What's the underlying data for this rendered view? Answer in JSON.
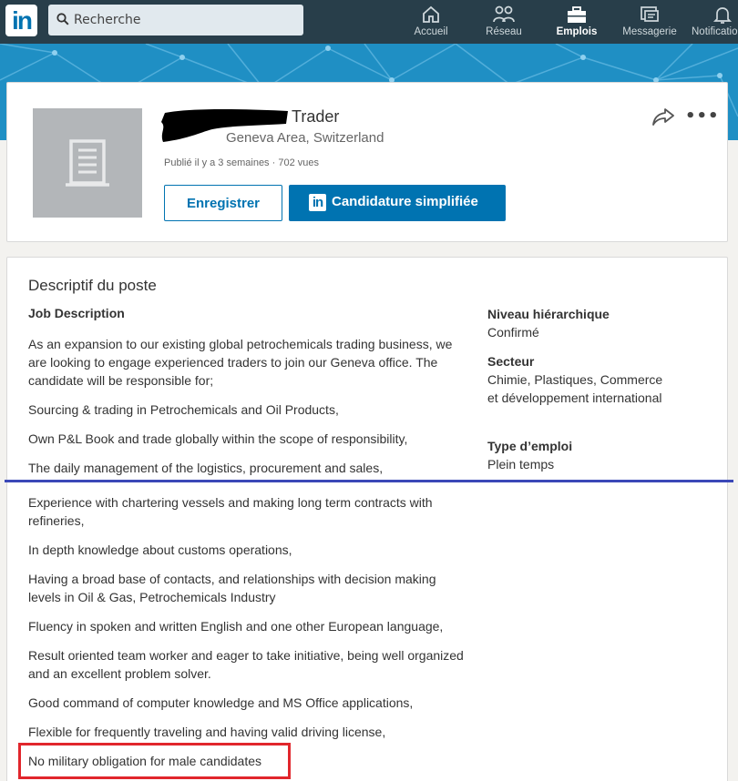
{
  "nav": {
    "logo": "in",
    "search_placeholder": "Recherche",
    "items": [
      {
        "label": "Accueil",
        "icon": "home-icon"
      },
      {
        "label": "Réseau",
        "icon": "network-icon"
      },
      {
        "label": "Emplois",
        "icon": "briefcase-icon",
        "active": true
      },
      {
        "label": "Messagerie",
        "icon": "messaging-icon"
      },
      {
        "label": "Notifications",
        "icon": "bell-icon"
      }
    ]
  },
  "job": {
    "title": "Trader",
    "location": "Geneva Area, Switzerland",
    "meta": "Publié il y a 3 semaines · 702 vues",
    "save_label": "Enregistrer",
    "apply_label": "Candidature simplifiée",
    "apply_badge": "in"
  },
  "description": {
    "heading": "Descriptif du poste",
    "subtitle": "Job Description",
    "paragraphs": [
      "As an expansion to our existing global petrochemicals trading business, we are looking to engage experienced traders to join our Geneva office. The candidate will be responsible for;",
      "Sourcing & trading in Petrochemicals and Oil Products,",
      "Own P&L Book and trade globally within the scope of responsibility,",
      "The daily management of the logistics, procurement and sales,",
      "Experience with chartering vessels and making long term contracts with refineries,",
      "In depth knowledge about customs operations,",
      "Having a broad base of contacts, and relationships with decision making levels in Oil & Gas, Petrochemicals Industry",
      "Fluency in spoken and written English and one other European language,",
      "Result oriented team worker and eager to take initiative, being well organized and an excellent problem solver.",
      "Good command of computer knowledge and MS Office applications,",
      "Flexible for frequently traveling and having valid driving license,",
      "No military obligation for male candidates"
    ]
  },
  "criteria": [
    {
      "label": "Niveau hiérarchique",
      "value": "Confirmé"
    },
    {
      "label": "Secteur",
      "value": "Chimie, Plastiques, Commerce et développement international"
    },
    {
      "label": "Type d’emploi",
      "value": "Plein temps"
    }
  ],
  "colors": {
    "brand": "#0073b1",
    "nav_bg": "#283e4a",
    "annotation_line": "#3b48b8",
    "annotation_box": "#e1262c"
  }
}
